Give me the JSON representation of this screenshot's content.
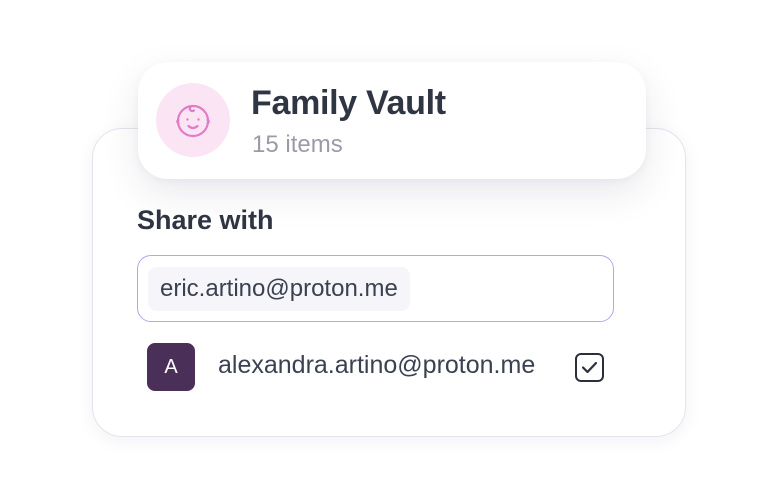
{
  "vault": {
    "title": "Family Vault",
    "item_count": "15 items",
    "icon": "baby-face-icon",
    "icon_color": "#e27cc8",
    "icon_bg": "#fbe4f3"
  },
  "share": {
    "label": "Share with",
    "input_value": "eric.artino@proton.me",
    "input_border_color": "#b3a8ec"
  },
  "member": {
    "avatar_initial": "A",
    "avatar_color": "#4a3058",
    "email": "alexandra.artino@proton.me",
    "selected": true
  }
}
